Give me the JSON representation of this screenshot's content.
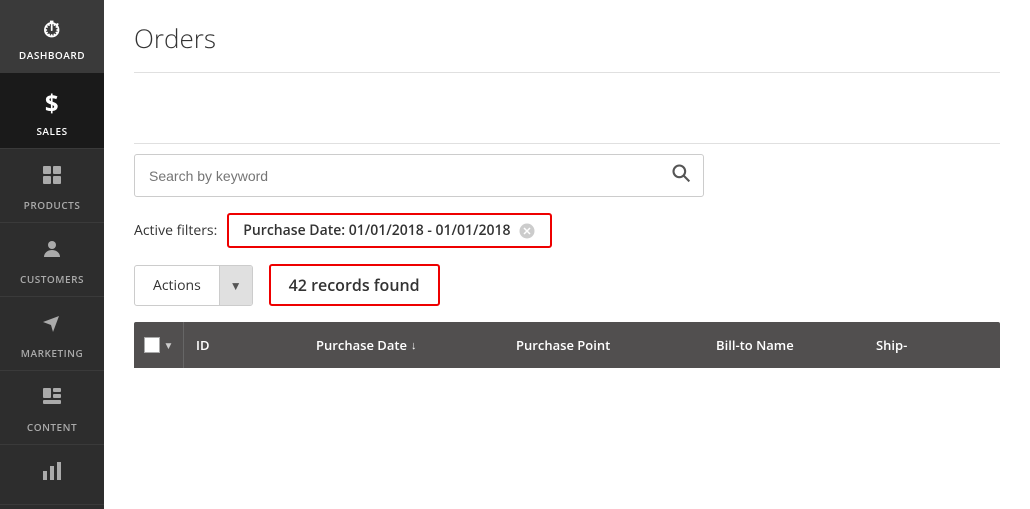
{
  "sidebar": {
    "items": [
      {
        "id": "dashboard",
        "label": "DASHBOARD",
        "icon": "🏎",
        "active": false
      },
      {
        "id": "sales",
        "label": "SALES",
        "icon": "$",
        "active": true
      },
      {
        "id": "products",
        "label": "PRODUCTS",
        "icon": "📦",
        "active": false
      },
      {
        "id": "customers",
        "label": "CUSTOMERS",
        "icon": "👤",
        "active": false
      },
      {
        "id": "marketing",
        "label": "MARKETING",
        "icon": "📢",
        "active": false
      },
      {
        "id": "content",
        "label": "CONTENT",
        "icon": "▦",
        "active": false
      },
      {
        "id": "reports",
        "label": "",
        "icon": "📊",
        "active": false
      }
    ]
  },
  "page": {
    "title": "Orders"
  },
  "search": {
    "placeholder": "Search by keyword"
  },
  "filters": {
    "label": "Active filters:",
    "tags": [
      {
        "text": "Purchase Date: 01/01/2018 - 01/01/2018"
      }
    ]
  },
  "toolbar": {
    "actions_label": "Actions",
    "records_found": "42 records found"
  },
  "table": {
    "columns": [
      {
        "id": "id",
        "label": "ID",
        "sortable": false
      },
      {
        "id": "purchase_date",
        "label": "Purchase Date",
        "sortable": true,
        "sort_dir": "desc"
      },
      {
        "id": "purchase_point",
        "label": "Purchase Point",
        "sortable": false
      },
      {
        "id": "bill_to_name",
        "label": "Bill-to Name",
        "sortable": false
      },
      {
        "id": "ship",
        "label": "Ship-",
        "sortable": false
      }
    ]
  }
}
